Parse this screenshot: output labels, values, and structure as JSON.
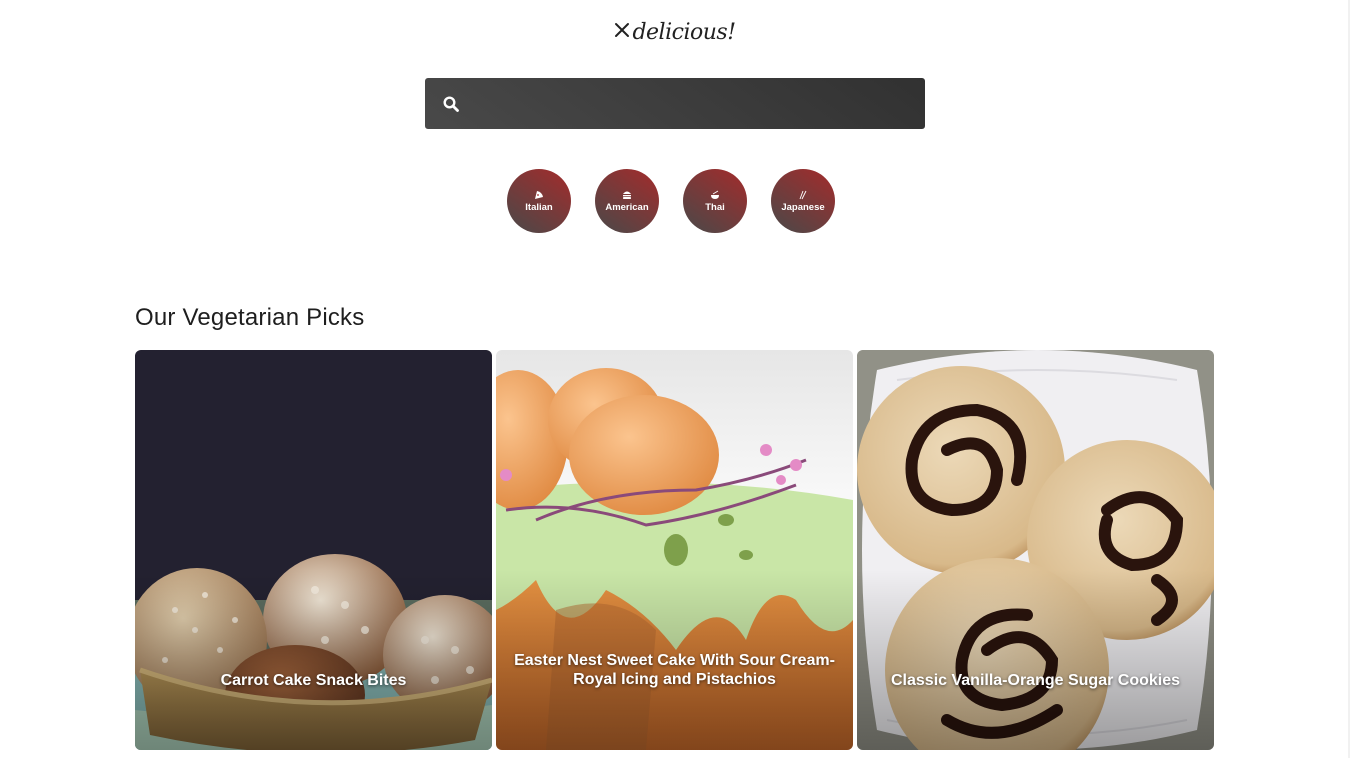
{
  "header": {
    "logo_text": "delicious!",
    "logo_icon": "crossed-utensils-icon"
  },
  "search": {
    "icon": "search-icon",
    "value": "",
    "placeholder": ""
  },
  "cuisines": [
    {
      "label": "Italian",
      "icon": "pizza-icon"
    },
    {
      "label": "American",
      "icon": "hamburger-icon"
    },
    {
      "label": "Thai",
      "icon": "noodle-bowl-icon"
    },
    {
      "label": "Japanese",
      "icon": "chopsticks-icon"
    }
  ],
  "section": {
    "title": "Our Vegetarian Picks"
  },
  "recipes": [
    {
      "title": "Carrot Cake Snack Bites"
    },
    {
      "title": "Easter Nest Sweet Cake With Sour Cream-Royal Icing and Pistachios"
    },
    {
      "title": "Classic Vanilla-Orange Sugar Cookies"
    }
  ],
  "colors": {
    "cuisine_gradient_start": "#494949",
    "cuisine_gradient_end": "#a42b2b",
    "search_bg": "#3f3f3f"
  }
}
